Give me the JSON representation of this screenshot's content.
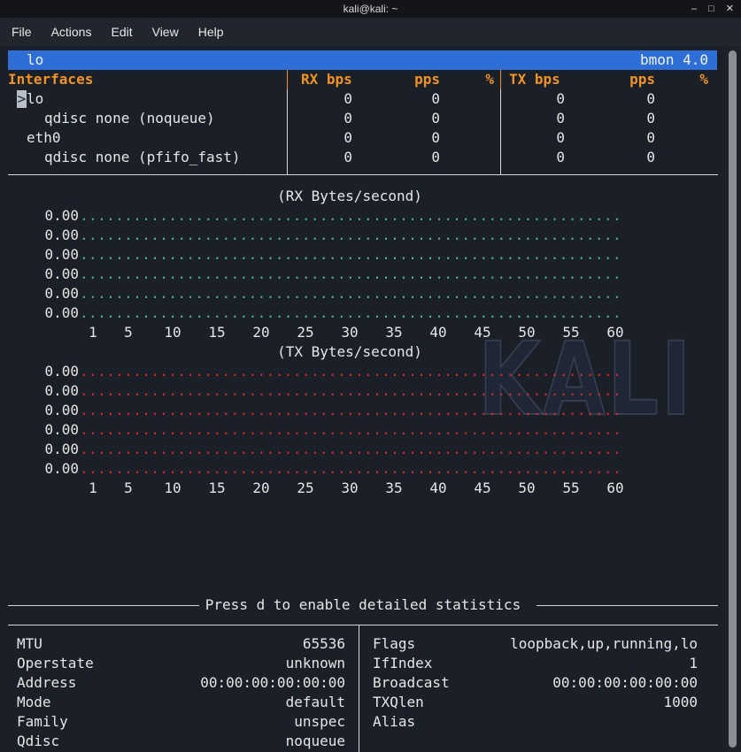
{
  "window": {
    "title": "kali@kali: ~",
    "controls": [
      {
        "name": "minimize",
        "glyph": "–"
      },
      {
        "name": "maximize",
        "glyph": "□"
      },
      {
        "name": "close",
        "glyph": "✕"
      }
    ]
  },
  "menu": {
    "items": [
      "File",
      "Actions",
      "Edit",
      "View",
      "Help"
    ]
  },
  "statusbar": {
    "left": "lo",
    "right": "bmon 4.0"
  },
  "table": {
    "headers": {
      "name": "Interfaces",
      "rx_bps": "RX bps",
      "rx_pps": "pps",
      "rx_pct": "%",
      "tx_bps": "TX bps",
      "tx_pps": "pps",
      "tx_pct": "%"
    },
    "rows": [
      {
        "name": "lo",
        "level": 0,
        "selected": true,
        "cursor": ">",
        "rx_bps": "0",
        "rx_pps": "0",
        "rx_pct": "",
        "tx_bps": "0",
        "tx_pps": "0",
        "tx_pct": ""
      },
      {
        "name": "qdisc none (noqueue)",
        "level": 1,
        "selected": false,
        "cursor": "",
        "rx_bps": "0",
        "rx_pps": "0",
        "rx_pct": "",
        "tx_bps": "0",
        "tx_pps": "0",
        "tx_pct": ""
      },
      {
        "name": "eth0",
        "level": 0,
        "selected": false,
        "cursor": "",
        "rx_bps": "0",
        "rx_pps": "0",
        "rx_pct": "",
        "tx_bps": "0",
        "tx_pps": "0",
        "tx_pct": ""
      },
      {
        "name": "qdisc none (pfifo_fast)",
        "level": 1,
        "selected": false,
        "cursor": "",
        "rx_bps": "0",
        "rx_pps": "0",
        "rx_pct": "",
        "tx_bps": "0",
        "tx_pps": "0",
        "tx_pct": ""
      }
    ]
  },
  "chart_data": [
    {
      "type": "scatter",
      "title": "(RX Bytes/second)",
      "x": "seconds 1-60",
      "x_ticks": [
        "1",
        "5",
        "10",
        "15",
        "20",
        "25",
        "30",
        "35",
        "40",
        "45",
        "50",
        "55",
        "60"
      ],
      "y_axis_labels": [
        "0.00",
        "0.00",
        "0.00",
        "0.00",
        "0.00",
        "0.00"
      ],
      "values": "all 0 (flat line, 60 samples)",
      "dot_color": "#4fb295",
      "rows": 6,
      "cols": 61
    },
    {
      "type": "scatter",
      "title": "(TX Bytes/second)",
      "x": "seconds 1-60",
      "x_ticks": [
        "1",
        "5",
        "10",
        "15",
        "20",
        "25",
        "30",
        "35",
        "40",
        "45",
        "50",
        "55",
        "60"
      ],
      "y_axis_labels": [
        "0.00",
        "0.00",
        "0.00",
        "0.00",
        "0.00",
        "0.00"
      ],
      "values": "all 0 (flat line, 60 samples)",
      "dot_color": "#da2a2a",
      "rows": 6,
      "cols": 61
    }
  ],
  "footer": {
    "hint": "Press d to enable detailed statistics"
  },
  "details": {
    "left": [
      {
        "label": "MTU",
        "value": "65536"
      },
      {
        "label": "Operstate",
        "value": "unknown"
      },
      {
        "label": "Address",
        "value": "00:00:00:00:00:00"
      },
      {
        "label": "Mode",
        "value": "default"
      },
      {
        "label": "Family",
        "value": "unspec"
      },
      {
        "label": "Qdisc",
        "value": "noqueue"
      }
    ],
    "right": [
      {
        "label": "Flags",
        "value": "loopback,up,running,lo"
      },
      {
        "label": "IfIndex",
        "value": "1"
      },
      {
        "label": "Broadcast",
        "value": "00:00:00:00:00:00"
      },
      {
        "label": "TXQlen",
        "value": "1000"
      },
      {
        "label": "Alias",
        "value": ""
      }
    ]
  },
  "watermark": {
    "text": "KALI"
  },
  "colors": {
    "terminal_bg": "#1a1f28",
    "titlebar_bg": "#131519",
    "menubar_bg": "#21252e",
    "selection_blue": "#2d6ed7",
    "header_orange": "#f09325",
    "rx_dot": "#4fb295",
    "tx_dot": "#da2a2a",
    "foreground": "#e6e6e4",
    "line_grey": "#d4d6d9",
    "cursor_bg": "#b9bfc8"
  }
}
